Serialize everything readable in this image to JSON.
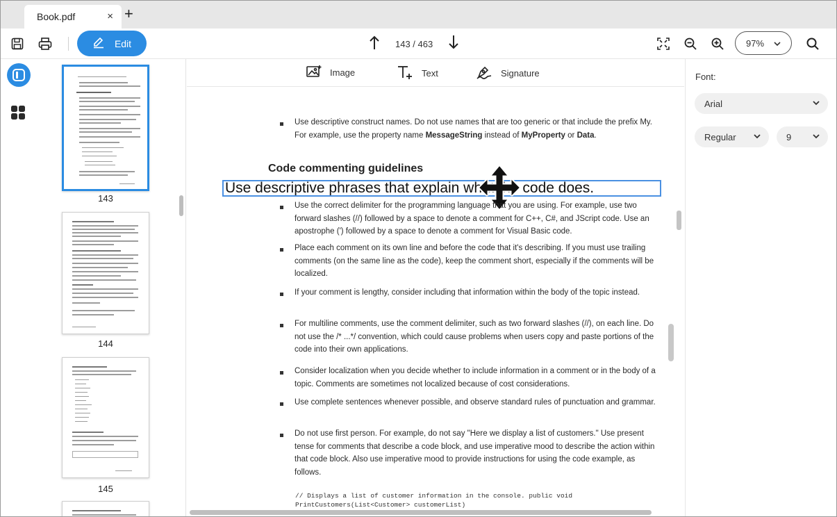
{
  "tabs": [
    {
      "label": "Book.pdf",
      "close": "×"
    }
  ],
  "new_tab": "+",
  "toolbar": {
    "save_icon": "save-icon",
    "print_icon": "print-icon",
    "edit_label": "Edit",
    "page_indicator": "143 / 463",
    "zoom_value": "97%",
    "accent": "#2b8ce2"
  },
  "insert_bar": {
    "image_label": "Image",
    "text_label": "Text",
    "signature_label": "Signature"
  },
  "thumbnails": [
    {
      "label": "143",
      "active": true
    },
    {
      "label": "144",
      "active": false
    },
    {
      "label": "145",
      "active": false
    }
  ],
  "document": {
    "intro_bullet": "Use descriptive construct names. Do not use names that are too generic or that include the prefix My. For example, use the property name ",
    "intro_bold1": "MessageString",
    "intro_mid": " instead of ",
    "intro_bold2": "MyProperty",
    "intro_or": " or ",
    "intro_bold3": "Data",
    "intro_end": ".",
    "heading": "Code commenting guidelines",
    "edit_text": "Use descriptive phrases that explain what the code does.",
    "bullets": [
      "Use the correct delimiter for the programming language that you are using. For example, use two forward slashes (//) followed by a space to denote a comment for C++, C#, and JScript code. Use an apostrophe (') followed by a space to denote a comment for Visual Basic code.",
      "Place each comment on its own line and before the code that it's describing. If you must use trailing comments (on the same line as the code), keep the comment short, especially if the comments will be localized.",
      "If your comment is lengthy, consider including that information within the body of the topic instead.",
      "For multiline comments, use the comment delimiter, such as two forward slashes (//), on each line. Do not use the /* ...*/ convention, which could cause problems when users copy and paste portions of the code into their own applications.",
      "Consider localization when you decide whether to include information in a comment or in the body of a topic. Comments are sometimes not localized because of cost considerations.",
      "Use complete sentences whenever possible, and observe standard rules of punctuation and grammar.",
      "Do not use first person. For example, do not say \"Here we display a list of customers.\" Use present tense for comments that describe a code block, and use imperative mood to describe the action within that code block. Also use imperative mood to provide instructions for using the code example, as follows."
    ],
    "code_line1": "// Displays a list of customer information in the console. public void",
    "code_line2": "PrintCustomers(List<Customer> customerList)"
  },
  "properties": {
    "font_label": "Font:",
    "font_family": "Arial",
    "font_style": "Regular",
    "font_size": "9"
  }
}
